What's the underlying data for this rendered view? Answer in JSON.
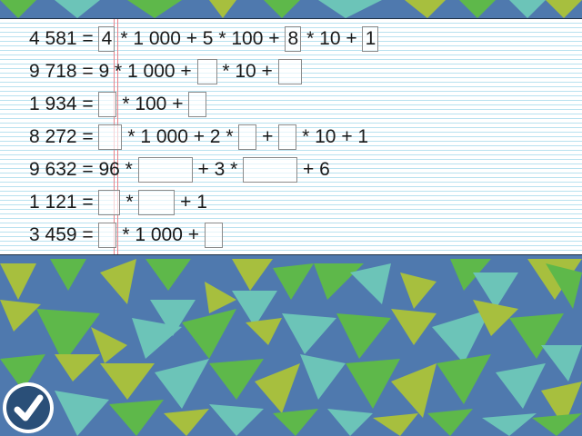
{
  "theme": {
    "background": "#4f79ae",
    "triangle_colors": [
      "#6cc4b8",
      "#5eb84a",
      "#a7bf3e"
    ]
  },
  "exercises": [
    {
      "parts": [
        {
          "type": "text",
          "value": "4 581 = "
        },
        {
          "type": "box",
          "value": "4"
        },
        {
          "type": "text",
          "value": " * 1 000 + 5 * 100 + "
        },
        {
          "type": "box",
          "value": "8"
        },
        {
          "type": "text",
          "value": " * 10 + "
        },
        {
          "type": "box",
          "value": "1"
        }
      ]
    },
    {
      "parts": [
        {
          "type": "text",
          "value": "9 718 = 9 * 1 000 + "
        },
        {
          "type": "box",
          "value": ""
        },
        {
          "type": "text",
          "value": " * 10 + "
        },
        {
          "type": "box",
          "value": ""
        }
      ]
    },
    {
      "parts": [
        {
          "type": "text",
          "value": "1 934 = "
        },
        {
          "type": "box",
          "value": ""
        },
        {
          "type": "text",
          "value": " * 100 + "
        },
        {
          "type": "box",
          "value": ""
        }
      ]
    },
    {
      "parts": [
        {
          "type": "text",
          "value": "8 272 = "
        },
        {
          "type": "box",
          "value": ""
        },
        {
          "type": "text",
          "value": " * 1 000 + 2 * "
        },
        {
          "type": "box",
          "value": ""
        },
        {
          "type": "text",
          "value": " + "
        },
        {
          "type": "box",
          "value": ""
        },
        {
          "type": "text",
          "value": " * 10 + 1"
        }
      ]
    },
    {
      "parts": [
        {
          "type": "text",
          "value": "9 632 = 96 * "
        },
        {
          "type": "box",
          "value": ""
        },
        {
          "type": "text",
          "value": " + 3 * "
        },
        {
          "type": "box",
          "value": ""
        },
        {
          "type": "text",
          "value": " + 6"
        }
      ]
    },
    {
      "parts": [
        {
          "type": "text",
          "value": "1 121 = "
        },
        {
          "type": "box",
          "value": ""
        },
        {
          "type": "text",
          "value": " * "
        },
        {
          "type": "box",
          "value": ""
        },
        {
          "type": "text",
          "value": " + 1"
        }
      ]
    },
    {
      "parts": [
        {
          "type": "text",
          "value": "3 459 = "
        },
        {
          "type": "box",
          "value": ""
        },
        {
          "type": "text",
          "value": " * 1 000 + "
        },
        {
          "type": "box",
          "value": ""
        }
      ]
    }
  ],
  "check_button": {
    "icon": "checkmark-icon"
  }
}
